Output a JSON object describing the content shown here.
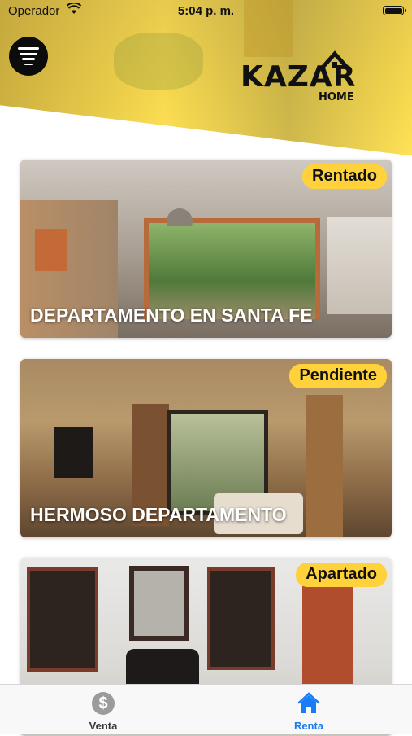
{
  "status_bar": {
    "carrier": "Operador",
    "time": "5:04 p. m."
  },
  "header": {
    "logo_word": "KAZAR",
    "logo_sub": "HOME"
  },
  "listings": [
    {
      "title": "DEPARTAMENTO EN SANTA FE",
      "status": "Rentado"
    },
    {
      "title": "HERMOSO DEPARTAMENTO",
      "status": "Pendiente"
    },
    {
      "title": "",
      "status": "Apartado"
    }
  ],
  "tabbar": {
    "items": [
      {
        "label": "Venta",
        "icon": "dollar-coin-icon",
        "color": "#3a3a3a",
        "active": false
      },
      {
        "label": "Renta",
        "icon": "house-icon",
        "color": "#1a7cf5",
        "active": true
      }
    ]
  },
  "colors": {
    "accent": "#ffd23c",
    "header_yellow": "#f6d84e",
    "tab_active": "#1a7cf5"
  }
}
